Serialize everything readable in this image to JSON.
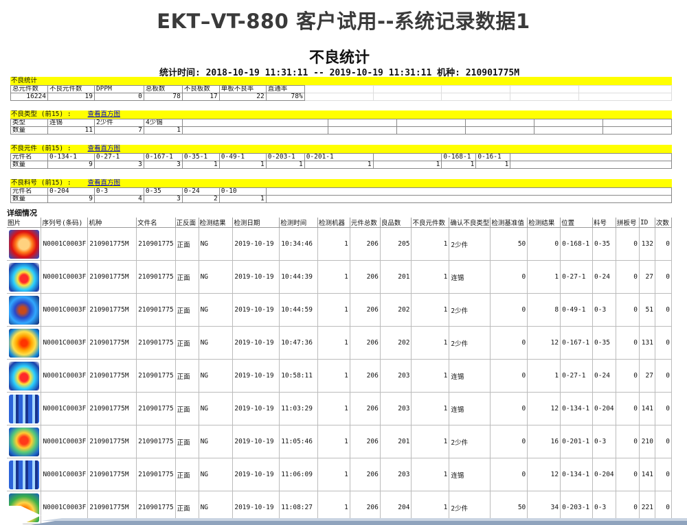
{
  "slide": {
    "title": "EKT–VT-880 客户试用--系统记录数据1"
  },
  "report": {
    "title": "不良统计",
    "subtitle": "统计时间: 2018-10-19 11:31:11 -- 2019-10-19 11:31:11 机种: 210901775M"
  },
  "summary": {
    "header": "不良统计",
    "columns": [
      "总元件数",
      "不良元件数",
      "DPPM",
      "总板数",
      "不良板数",
      "单板不良率",
      "直通率"
    ],
    "values": [
      "16224",
      "19",
      "0",
      "78",
      "17",
      "22",
      "78%"
    ]
  },
  "defect_types": {
    "header": "不良类型 (前15) :",
    "link": "查看直方图",
    "row1_label": "类型",
    "row2_label": "数量",
    "names": [
      "连锡",
      "2少件",
      "4少锡"
    ],
    "counts": [
      "11",
      "7",
      "1"
    ]
  },
  "defect_parts": {
    "header": "不良元件 (前15) :",
    "link": "查看直方图",
    "row1_label": "元件名",
    "row2_label": "数量",
    "names": [
      "0-134-1",
      "0-27-1",
      "0-167-1",
      "0-35-1",
      "0-49-1",
      "0-203-1",
      "0-201-1",
      "",
      "0-168-1",
      "0-16-1"
    ],
    "counts": [
      "9",
      "3",
      "3",
      "1",
      "1",
      "1",
      "1",
      "1",
      "1",
      "1"
    ]
  },
  "defect_materials": {
    "header": "不良料号 (前15) :",
    "link": "查看直方图",
    "row1_label": "元件名",
    "row2_label": "数量",
    "names": [
      "0-204",
      "0-3",
      "0-35",
      "0-24",
      "0-10"
    ],
    "counts": [
      "9",
      "4",
      "3",
      "2",
      "1"
    ]
  },
  "detail": {
    "header": "详细情况",
    "columns": [
      "图片",
      "序列号(条码)",
      "机种",
      "文件名",
      "正反面",
      "检测结果",
      "检测日期",
      "检测时间",
      "检测机器",
      "元件总数",
      "良品数",
      "不良元件数",
      "确认不良类型",
      "检测基准值",
      "检测结果",
      "位置",
      "料号",
      "拼板号",
      "ID",
      "次数"
    ],
    "rows": [
      {
        "serial": "N0001C0003F",
        "model": "210901775M",
        "file": "210901775",
        "side": "正面",
        "result": "NG",
        "date": "2019-10-19",
        "time": "10:34:46",
        "machine": "1",
        "total": "206",
        "good": "205",
        "bad": "1",
        "type": "2少件",
        "base": "50",
        "value": "0",
        "pos": "0-168-1",
        "part": "0-35",
        "panel": "0",
        "id": "132",
        "count": "0"
      },
      {
        "serial": "N0001C0003F",
        "model": "210901775M",
        "file": "210901775",
        "side": "正面",
        "result": "NG",
        "date": "2019-10-19",
        "time": "10:44:39",
        "machine": "1",
        "total": "206",
        "good": "201",
        "bad": "1",
        "type": "连锡",
        "base": "0",
        "value": "1",
        "pos": "0-27-1",
        "part": "0-24",
        "panel": "0",
        "id": "27",
        "count": "0"
      },
      {
        "serial": "N0001C0003F",
        "model": "210901775M",
        "file": "210901775",
        "side": "正面",
        "result": "NG",
        "date": "2019-10-19",
        "time": "10:44:59",
        "machine": "1",
        "total": "206",
        "good": "202",
        "bad": "1",
        "type": "2少件",
        "base": "0",
        "value": "8",
        "pos": "0-49-1",
        "part": "0-3",
        "panel": "0",
        "id": "51",
        "count": "0"
      },
      {
        "serial": "N0001C0003F",
        "model": "210901775M",
        "file": "210901775",
        "side": "正面",
        "result": "NG",
        "date": "2019-10-19",
        "time": "10:47:36",
        "machine": "1",
        "total": "206",
        "good": "202",
        "bad": "1",
        "type": "2少件",
        "base": "0",
        "value": "12",
        "pos": "0-167-1",
        "part": "0-35",
        "panel": "0",
        "id": "131",
        "count": "0"
      },
      {
        "serial": "N0001C0003F",
        "model": "210901775M",
        "file": "210901775",
        "side": "正面",
        "result": "NG",
        "date": "2019-10-19",
        "time": "10:58:11",
        "machine": "1",
        "total": "206",
        "good": "203",
        "bad": "1",
        "type": "连锡",
        "base": "0",
        "value": "1",
        "pos": "0-27-1",
        "part": "0-24",
        "panel": "0",
        "id": "27",
        "count": "0"
      },
      {
        "serial": "N0001C0003F",
        "model": "210901775M",
        "file": "210901775",
        "side": "正面",
        "result": "NG",
        "date": "2019-10-19",
        "time": "11:03:29",
        "machine": "1",
        "total": "206",
        "good": "203",
        "bad": "1",
        "type": "连锡",
        "base": "0",
        "value": "12",
        "pos": "0-134-1",
        "part": "0-204",
        "panel": "0",
        "id": "141",
        "count": "0"
      },
      {
        "serial": "N0001C0003F",
        "model": "210901775M",
        "file": "210901775",
        "side": "正面",
        "result": "NG",
        "date": "2019-10-19",
        "time": "11:05:46",
        "machine": "1",
        "total": "206",
        "good": "201",
        "bad": "1",
        "type": "2少件",
        "base": "0",
        "value": "16",
        "pos": "0-201-1",
        "part": "0-3",
        "panel": "0",
        "id": "210",
        "count": "0"
      },
      {
        "serial": "N0001C0003F",
        "model": "210901775M",
        "file": "210901775",
        "side": "正面",
        "result": "NG",
        "date": "2019-10-19",
        "time": "11:06:09",
        "machine": "1",
        "total": "206",
        "good": "203",
        "bad": "1",
        "type": "连锡",
        "base": "0",
        "value": "12",
        "pos": "0-134-1",
        "part": "0-204",
        "panel": "0",
        "id": "141",
        "count": "0"
      },
      {
        "serial": "N0001C0003F",
        "model": "210901775M",
        "file": "210901775",
        "side": "正面",
        "result": "NG",
        "date": "2019-10-19",
        "time": "11:08:27",
        "machine": "1",
        "total": "206",
        "good": "204",
        "bad": "1",
        "type": "2少件",
        "base": "50",
        "value": "34",
        "pos": "0-203-1",
        "part": "0-3",
        "panel": "0",
        "id": "221",
        "count": "0"
      }
    ]
  }
}
